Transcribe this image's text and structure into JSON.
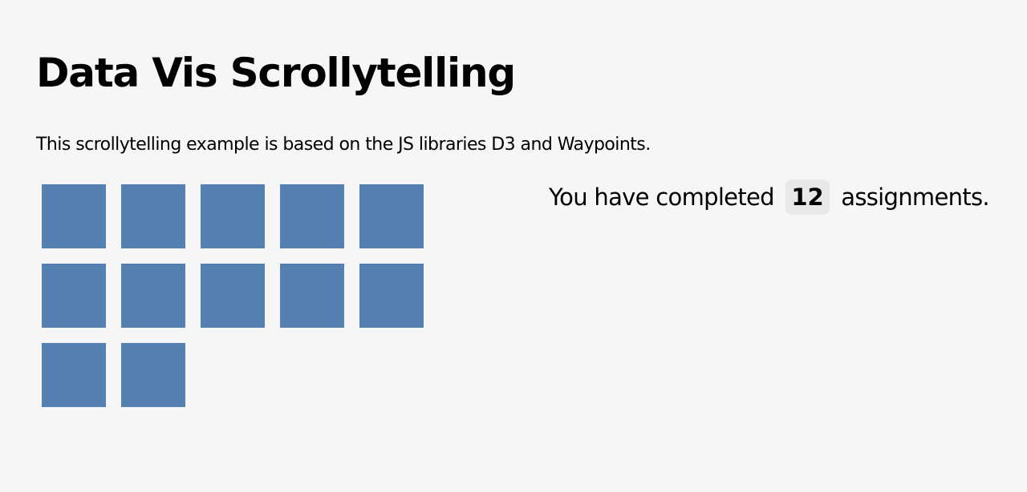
{
  "page": {
    "title": "Data Vis Scrollytelling",
    "intro": "This scrollytelling example is based on the JS libraries D3 and Waypoints."
  },
  "status": {
    "prefix": "You have completed",
    "count": "12",
    "suffix": "assignments."
  },
  "colors": {
    "square": "#5581b2",
    "background": "#f6f6f6",
    "badge": "#eae8e6"
  },
  "grid": {
    "completed_assignments": 12
  }
}
